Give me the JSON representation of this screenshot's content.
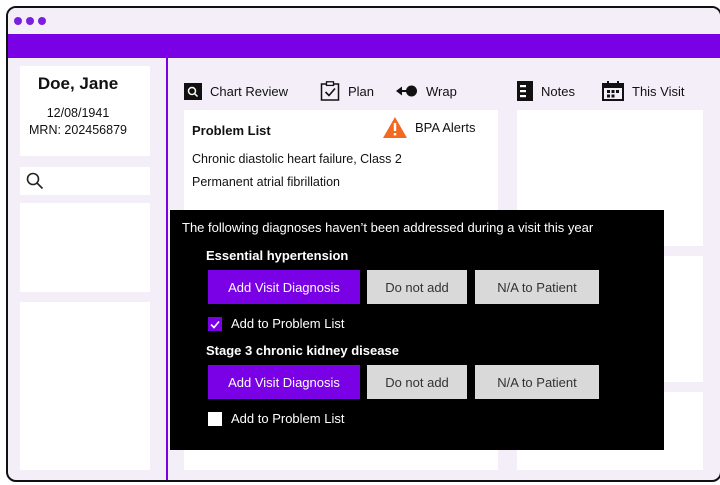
{
  "patient": {
    "name": "Doe, Jane",
    "dob": "12/08/1941",
    "mrn": "MRN: 202456879"
  },
  "nav": {
    "chart_review": "Chart Review",
    "plan": "Plan",
    "wrap": "Wrap",
    "notes": "Notes",
    "this_visit": "This Visit"
  },
  "problem_list": {
    "title": "Problem List",
    "items": [
      "Chronic diastolic heart failure, Class 2",
      "Permanent atrial fibrillation"
    ],
    "alerts_label": "BPA Alerts"
  },
  "modal": {
    "message": "The following diagnoses haven’t been addressed during a visit this year",
    "diagnoses": [
      {
        "title": "Essential hypertension",
        "add_label": "Add Visit Diagnosis",
        "do_not_add_label": "Do not add",
        "na_label": "N/A to Patient",
        "add_to_problem_list_label": "Add to Problem List",
        "add_to_problem_list_checked": true
      },
      {
        "title": "Stage 3 chronic kidney disease",
        "add_label": "Add Visit Diagnosis",
        "do_not_add_label": "Do not add",
        "na_label": "N/A to Patient",
        "add_to_problem_list_label": "Add to Problem List",
        "add_to_problem_list_checked": false
      }
    ]
  },
  "colors": {
    "brand_purple": "#7a00e6",
    "alert_orange": "#f26a21",
    "background": "#f3eef8"
  }
}
